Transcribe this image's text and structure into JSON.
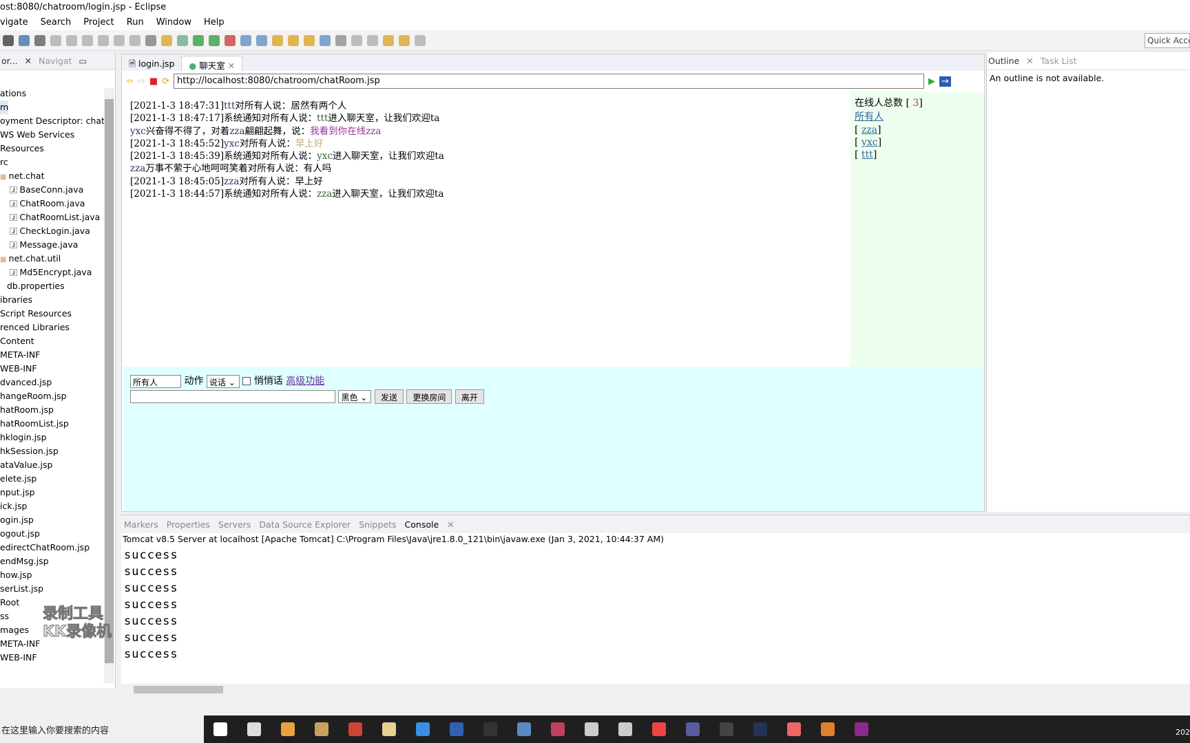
{
  "window": {
    "title": "ost:8080/chatroom/login.jsp - Eclipse"
  },
  "menu": [
    "vigate",
    "Search",
    "Project",
    "Run",
    "Window",
    "Help"
  ],
  "quick_access": "Quick Acce",
  "left_panel": {
    "tabs": [
      "or...",
      "Navigat"
    ],
    "tree": [
      "ations",
      "m",
      "oyment Descriptor: chatrc",
      "WS Web Services",
      "Resources",
      "rc",
      "net.chat",
      "BaseConn.java",
      "ChatRoom.java",
      "ChatRoomList.java",
      "CheckLogin.java",
      "Message.java",
      "net.chat.util",
      "Md5Encrypt.java",
      "db.properties",
      "ibraries",
      "Script Resources",
      "renced Libraries",
      "Content",
      "META-INF",
      "WEB-INF",
      "dvanced.jsp",
      "hangeRoom.jsp",
      "hatRoom.jsp",
      "hatRoomList.jsp",
      "hklogin.jsp",
      "hkSession.jsp",
      "ataValue.jsp",
      "elete.jsp",
      "nput.jsp",
      "ick.jsp",
      "ogin.jsp",
      "ogout.jsp",
      "edirectChatRoom.jsp",
      "endMsg.jsp",
      "how.jsp",
      "serList.jsp",
      "Root",
      "ss",
      "mages",
      "META-INF",
      "WEB-INF"
    ]
  },
  "editor": {
    "tabs": [
      "login.jsp",
      "聊天室"
    ],
    "url": "http://localhost:8080/chatroom/chatRoom.jsp",
    "messages": [
      [
        {
          "t": "[2021-1-3 18:47:31]"
        },
        {
          "t": "ttt",
          "c": "#333366"
        },
        {
          "t": "对所有人说：居然有两个人"
        }
      ],
      [
        {
          "t": "[2021-1-3 18:47:17]系统通知对所有人说："
        },
        {
          "t": "ttt",
          "c": "#336633"
        },
        {
          "t": "进入聊天室，让我们欢迎ta"
        }
      ],
      [
        {
          "t": "yxc",
          "c": "#333366"
        },
        {
          "t": "兴奋得不得了，对着"
        },
        {
          "t": "zza",
          "c": "#333366"
        },
        {
          "t": "翩翩起舞，说："
        },
        {
          "t": "我看到你在线zza",
          "c": "#993399"
        }
      ],
      [
        {
          "t": "[2021-1-3 18:45:52]"
        },
        {
          "t": "yxc",
          "c": "#333366"
        },
        {
          "t": "对所有人说："
        },
        {
          "t": "早上好",
          "c": "#c8a87a"
        }
      ],
      [
        {
          "t": "[2021-1-3 18:45:39]系统通知对所有人说："
        },
        {
          "t": "yxc",
          "c": "#336633"
        },
        {
          "t": "进入聊天室，让我们欢迎ta"
        }
      ],
      [
        {
          "t": "zza",
          "c": "#333366"
        },
        {
          "t": "万事不萦于心地呵呵笑着对所有人说：有人吗"
        }
      ],
      [
        {
          "t": "[2021-1-3 18:45:05]"
        },
        {
          "t": "zza",
          "c": "#333366"
        },
        {
          "t": "对所有人说：早上好"
        }
      ],
      [
        {
          "t": "[2021-1-3 18:44:57]系统通知对所有人说："
        },
        {
          "t": "zza",
          "c": "#336633"
        },
        {
          "t": "进入聊天室，让我们欢迎ta"
        }
      ]
    ],
    "online": {
      "label": "在线人总数",
      "count": "3",
      "all": "所有人",
      "users": [
        "zza",
        "yxc",
        "ttt"
      ]
    },
    "form": {
      "target": "所有人",
      "action_label": "动作",
      "action_value": "说话",
      "whisper": "悄悄话",
      "advanced": "高级功能",
      "message": "",
      "color": "黑色",
      "send": "发送",
      "change_room": "更换房间",
      "leave": "离开"
    }
  },
  "outline": {
    "tabs": [
      "Outline",
      "Task List"
    ],
    "message": "An outline is not available."
  },
  "console": {
    "tabs": [
      "Markers",
      "Properties",
      "Servers",
      "Data Source Explorer",
      "Snippets",
      "Console"
    ],
    "header": "Tomcat v8.5 Server at localhost [Apache Tomcat] C:\\Program Files\\Java\\jre1.8.0_121\\bin\\javaw.exe (Jan 3, 2021, 10:44:37 AM)",
    "lines": [
      "success",
      "success",
      "success",
      "success",
      "success",
      "success",
      "success"
    ]
  },
  "watermark": [
    "录制工具",
    "KK录像机"
  ],
  "taskbar": {
    "search_placeholder": "在这里输入你要搜索的内容",
    "clock": "202"
  }
}
